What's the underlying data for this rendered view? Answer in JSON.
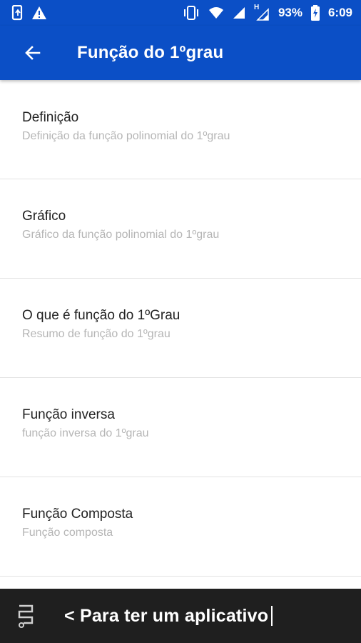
{
  "status_bar": {
    "battery_percent": "93%",
    "time": "6:09",
    "network_indicator": "H",
    "icons": [
      "phone-data-icon",
      "warning-icon",
      "vibrate-icon",
      "wifi-icon",
      "signal-icon",
      "signal-icon",
      "battery-icon"
    ]
  },
  "app_bar": {
    "title": "Função do 1ºgrau",
    "back_icon": "arrow-back-icon"
  },
  "list": {
    "items": [
      {
        "title": "Definição",
        "subtitle": "Definição da função polinomial do 1ºgrau"
      },
      {
        "title": "Gráfico",
        "subtitle": "Gráfico da função polinomial do 1ºgrau"
      },
      {
        "title": "O que é função do 1ºGrau",
        "subtitle": "Resumo de função do 1ºgrau"
      },
      {
        "title": "Função inversa",
        "subtitle": "função inversa do 1ºgrau"
      },
      {
        "title": "Função Composta",
        "subtitle": "Função composta"
      }
    ]
  },
  "banner": {
    "text": "< Para ter um aplicativo",
    "logo_icon": "app-builder-logo-icon"
  },
  "colors": {
    "primary": "#0b4fc6",
    "banner_bg": "#1f1f1f",
    "title_text": "#222222",
    "subtitle_text": "#b5b5b5",
    "divider": "#e3e3e3"
  }
}
